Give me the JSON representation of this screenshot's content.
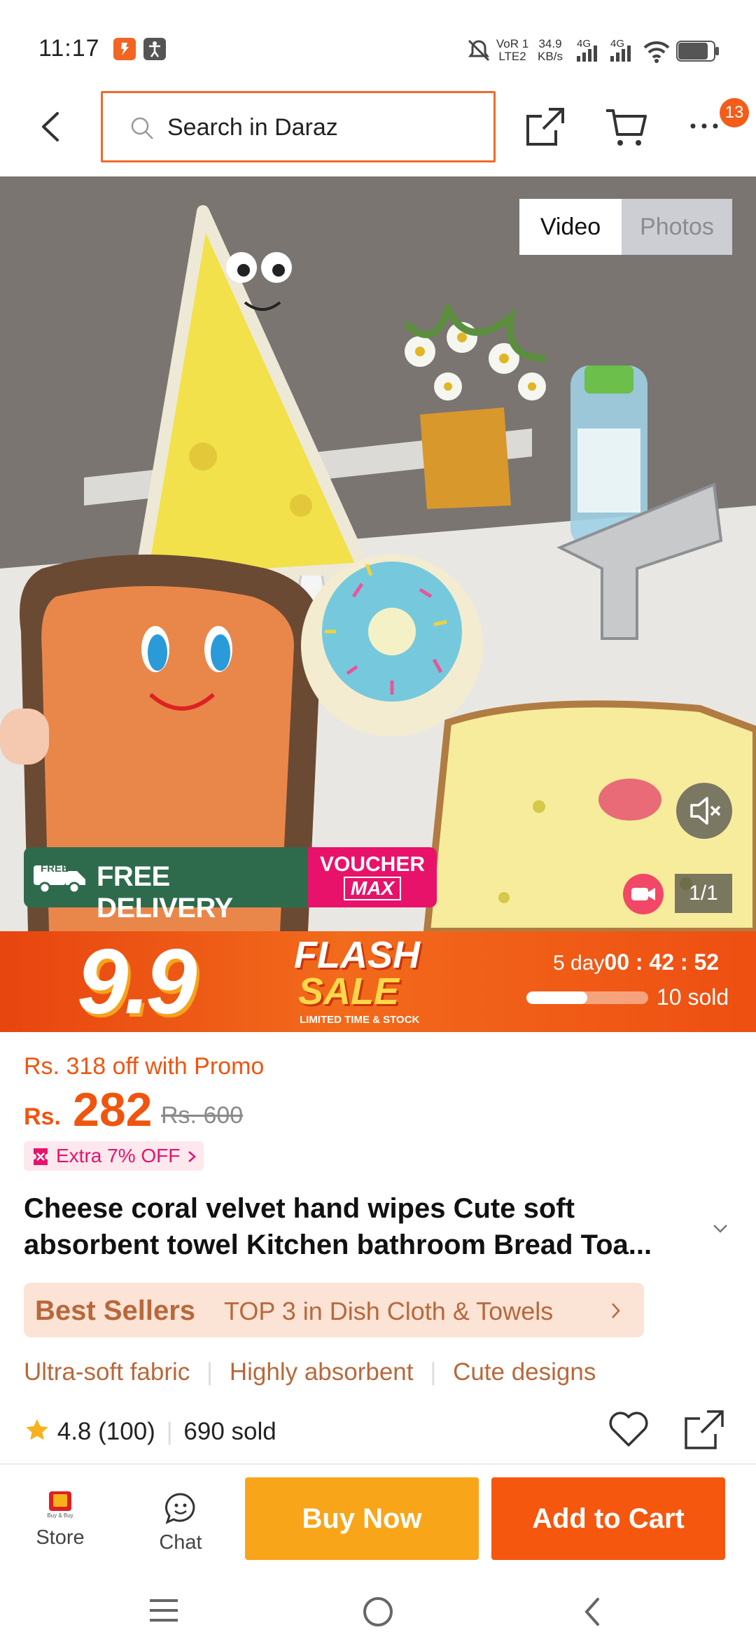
{
  "status_bar": {
    "time": "11:17",
    "network_label_1": "VoR 1",
    "network_label_2": "LTE2",
    "speed_value": "34.9",
    "speed_unit": "KB/s",
    "sim1_type": "4G",
    "sim2_type": "4G"
  },
  "header": {
    "search_placeholder": "Search in Daraz",
    "cart_badge_count": "13"
  },
  "media": {
    "tab_video": "Video",
    "tab_photos": "Photos",
    "free_delivery_badge": "FREE",
    "free_delivery_label": "FREE DELIVERY",
    "voucher_line1": "VOUCHER",
    "voucher_line2": "MAX",
    "counter": "1/1"
  },
  "flash_sale": {
    "event_label": "9.9",
    "title_line1": "FLASH",
    "title_line2": "SALE",
    "subtitle": "LIMITED TIME & STOCK",
    "countdown_days": "5 day",
    "countdown_time": "00 : 42 : 52",
    "sold_label": "10 sold",
    "sold_progress": 0.5
  },
  "price": {
    "promo_text": "Rs. 318 off with Promo",
    "currency": "Rs.",
    "current": "282",
    "original": "Rs. 600",
    "extra_offer": "Extra 7% OFF"
  },
  "product": {
    "title": "Cheese coral velvet hand wipes Cute soft absorbent towel Kitchen bathroom Bread Toa..."
  },
  "best_sellers": {
    "label": "Best Sellers",
    "rank_text": "TOP 3 in Dish Cloth & Towels"
  },
  "features": [
    "Ultra-soft fabric",
    "Highly absorbent",
    "Cute designs"
  ],
  "rating": {
    "score": "4.8",
    "count": "(100)",
    "sold": "690 sold"
  },
  "bottom_bar": {
    "store_label": "Store",
    "store_logo_text": "Buy & Buy",
    "chat_label": "Chat",
    "buy_now": "Buy Now",
    "add_to_cart": "Add to Cart"
  },
  "colors": {
    "accent": "#f0550f",
    "buy_now_bg": "#f9a51a",
    "add_to_cart_bg": "#f5570f",
    "best_sellers_bg": "#fbe3d6",
    "voucher_pink": "#e8126a",
    "delivery_green": "#2e6b4c"
  }
}
